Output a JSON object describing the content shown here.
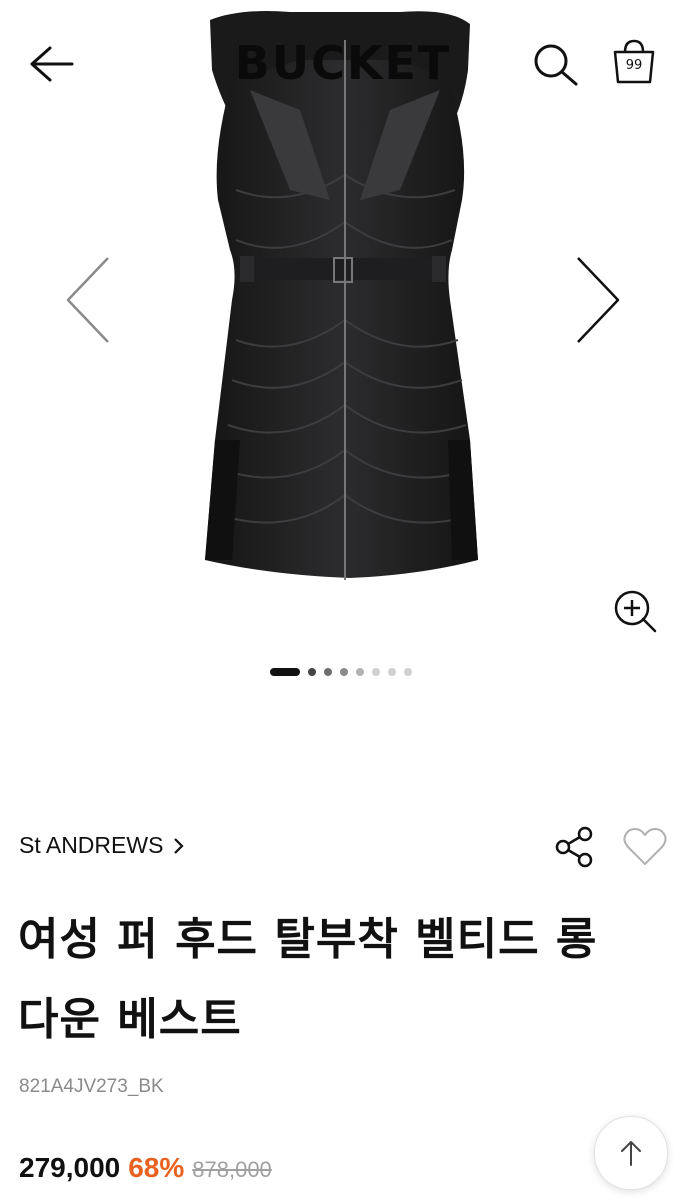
{
  "header": {
    "logo": "BUCKET",
    "bag_count": "99",
    "back_icon": "arrow-left-icon",
    "search_icon": "search-icon",
    "bag_icon": "shopping-bag-icon"
  },
  "gallery": {
    "prev_icon": "chevron-left-icon",
    "next_icon": "chevron-right-icon",
    "zoom_icon": "zoom-in-icon",
    "slide_count": 8,
    "active_slide": 1
  },
  "product": {
    "brand": "St ANDREWS",
    "brand_chevron": ">",
    "title_line1": "여성 퍼 후드 탈부착 벨티드 롱",
    "title_line2": "다운 베스트",
    "sku": "821A4JV273_BK",
    "price": "279,000",
    "discount": "68%",
    "original_price": "878,000",
    "share_icon": "share-icon",
    "wishlist_icon": "heart-icon"
  },
  "colors": {
    "discount": "#e9611f",
    "text": "#111111",
    "muted": "#8a8a8a"
  },
  "scroll_top_icon": "arrow-up-icon"
}
